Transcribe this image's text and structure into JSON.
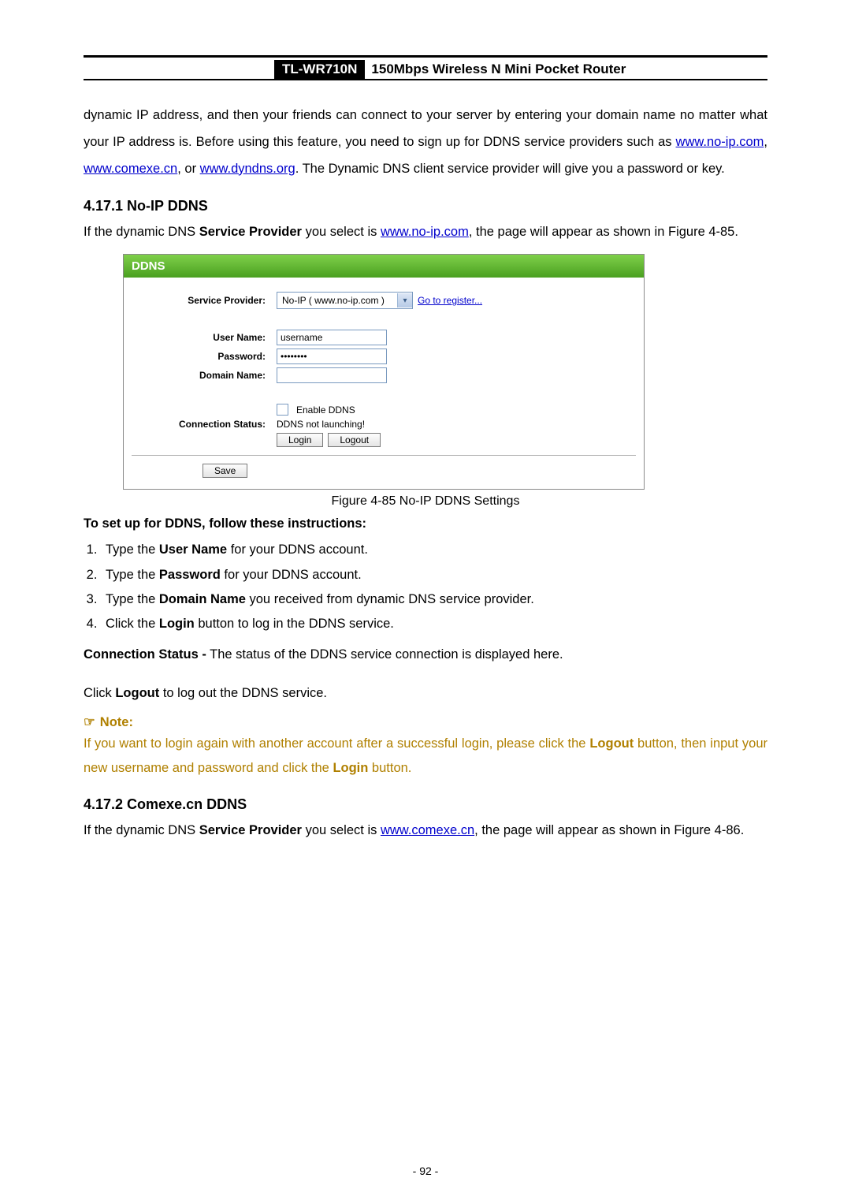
{
  "header": {
    "model": "TL-WR710N",
    "desc": "150Mbps Wireless N Mini Pocket Router"
  },
  "intro": {
    "text_before_links": "dynamic IP address, and then your friends can connect to your server by entering your domain name no matter what your IP address is. Before using this feature, you need to sign up for DDNS service providers such as ",
    "link1": "www.no-ip.com",
    "sep1": ", ",
    "link2": "www.comexe.cn",
    "sep2": ", or ",
    "link3": "www.dyndns.org",
    "text_after_links": ". The Dynamic DNS client service provider will give you a password or key."
  },
  "section1": {
    "heading": "4.17.1 No-IP DDNS",
    "intro_before": "If the dynamic DNS ",
    "intro_bold": "Service Provider",
    "intro_mid": " you select is ",
    "intro_link": "www.no-ip.com",
    "intro_after": ", the page will appear as shown in Figure 4-85."
  },
  "figure": {
    "title": "DDNS",
    "labels": {
      "service_provider": "Service Provider:",
      "user_name": "User Name:",
      "password": "Password:",
      "domain_name": "Domain Name:",
      "connection_status": "Connection Status:"
    },
    "select_value": "No-IP ( www.no-ip.com )",
    "go_register": "Go to register...",
    "user_name_value": "username",
    "password_value": "••••••••",
    "domain_name_value": "",
    "enable_ddns_label": "Enable DDNS",
    "status_text": "DDNS not launching!",
    "login_btn": "Login",
    "logout_btn": "Logout",
    "save_btn": "Save",
    "caption": "Figure 4-85 No-IP DDNS Settings"
  },
  "instructions": {
    "heading": "To set up for DDNS, follow these instructions:",
    "steps": [
      {
        "pre": "Type the ",
        "bold": "User Name",
        "post": " for your DDNS account."
      },
      {
        "pre": "Type the ",
        "bold": "Password",
        "post": " for your DDNS account."
      },
      {
        "pre": "Type the ",
        "bold": "Domain Name",
        "post": " you received from dynamic DNS service provider."
      },
      {
        "pre": "Click the ",
        "bold": "Login",
        "post": " button to log in the DDNS service."
      }
    ],
    "conn_status_bold": "Connection Status -",
    "conn_status_rest": " The status of the DDNS service connection is displayed here.",
    "logout_pre": "Click ",
    "logout_bold": "Logout",
    "logout_post": " to log out the DDNS service."
  },
  "note": {
    "label": "Note:",
    "body_pre": "If you want to login again with another account after a successful login, please click the ",
    "body_bold1": "Logout",
    "body_mid": " button, then input your new username and password and click the ",
    "body_bold2": "Login",
    "body_post": " button."
  },
  "section2": {
    "heading": "4.17.2 Comexe.cn DDNS",
    "intro_before": "If the dynamic DNS ",
    "intro_bold": "Service Provider",
    "intro_mid": " you select is ",
    "intro_link": "www.comexe.cn",
    "intro_after": ", the page will appear as shown in Figure 4-86."
  },
  "page_number": "- 92 -"
}
